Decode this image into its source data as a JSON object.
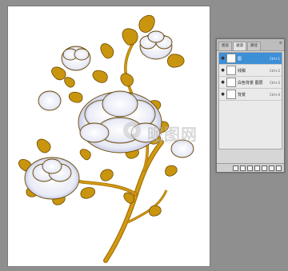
{
  "layers_panel": {
    "tabs": [
      "图层",
      "通道",
      "路径"
    ],
    "menu_icon": "panel-menu-icon",
    "layers": [
      {
        "name": "图",
        "shortcut": "Ctrl+1",
        "selected": true
      },
      {
        "name": "线稿",
        "shortcut": "Ctrl+2",
        "selected": false
      },
      {
        "name": "白色背景 图层",
        "shortcut": "Ctrl+3",
        "selected": false
      },
      {
        "name": "背景",
        "shortcut": "Ctrl+4",
        "selected": false
      }
    ],
    "footer_icons": [
      "link-icon",
      "fx-icon",
      "mask-icon",
      "adjustment-icon",
      "folder-icon",
      "new-layer-icon",
      "trash-icon"
    ]
  },
  "watermark": {
    "text": "昵图网",
    "subtext": "www.nipic.com"
  },
  "colors": {
    "workspace": "#8f8f8f",
    "leaf_gold": "#c9950f",
    "leaf_outline": "#6d4a00",
    "flower_fill": "#e9ebf6",
    "flower_shade": "#9ea7d6",
    "stem": "#c48b0c"
  }
}
